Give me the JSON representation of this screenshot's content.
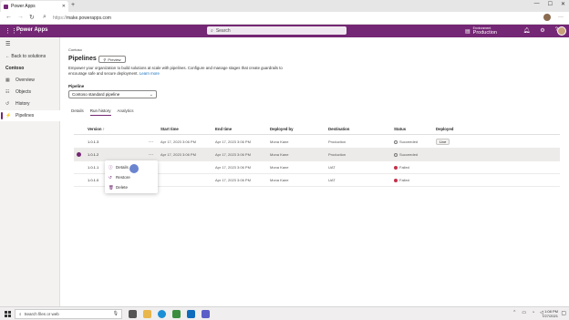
{
  "browser": {
    "tab_title": "Power Apps",
    "tab_close": "✕",
    "new_tab": "+",
    "url_prefix": "https://",
    "url": "make.powerapps.com"
  },
  "header": {
    "app_name": "Power Apps",
    "search_placeholder": "Search",
    "environment_label": "Environment",
    "environment_value": "Production"
  },
  "sidebar": {
    "back_label": "Back to solutions",
    "section": "Contoso",
    "items": [
      {
        "label": "Overview",
        "icon": "overview-icon"
      },
      {
        "label": "Objects",
        "icon": "objects-icon"
      },
      {
        "label": "History",
        "icon": "history-icon"
      },
      {
        "label": "Pipelines",
        "icon": "pipelines-icon",
        "active": true
      }
    ]
  },
  "main": {
    "breadcrumb": "Contoso",
    "title": "Pipelines",
    "preview_label": "Preview",
    "description": "Empower your organization to build solutions at scale with pipelines. Configure and manage stages that create guardrails to encourage safe and secure deployment.",
    "learn_more": "Learn more",
    "pipeline_label": "Pipeline",
    "pipeline_value": "Contoso standard pipeline",
    "tabs": [
      {
        "label": "Details"
      },
      {
        "label": "Run history",
        "active": true
      },
      {
        "label": "Analytics"
      }
    ]
  },
  "grid": {
    "columns": [
      "Version",
      "Start time",
      "End time",
      "Deployed by",
      "Destination",
      "Status",
      "Deployed"
    ],
    "sort_indicator": "↑",
    "row_menu": "···",
    "rows": [
      {
        "version": "1.0.1.3",
        "start": "Apr 17, 2023 3:06 PM",
        "end": "Apr 17, 2023 3:06 PM",
        "by": "Mona Kane",
        "dest": "Production",
        "status": "Succeeded",
        "deployed": "Live"
      },
      {
        "version": "1.0.1.2",
        "start": "Apr 17, 2023 3:06 PM",
        "end": "Apr 17, 2023 3:06 PM",
        "by": "Mona Kane",
        "dest": "Production",
        "status": "Succeeded",
        "deployed": ""
      },
      {
        "version": "1.0.1.1",
        "start": "Apr 17, 2023 3:06 PM",
        "end": "Apr 17, 2023 3:06 PM",
        "by": "Mona Kane",
        "dest": "UAT",
        "status": "Failed",
        "deployed": ""
      },
      {
        "version": "1.0.1.0",
        "start": "Apr 17, 2023 3:06 PM",
        "end": "Apr 17, 2023 3:06 PM",
        "by": "Mona Kane",
        "dest": "UAT",
        "status": "Failed",
        "deployed": ""
      }
    ]
  },
  "context_menu": {
    "items": [
      "Details",
      "Restore",
      "Delete"
    ]
  },
  "taskbar": {
    "search_placeholder": "Search files or web",
    "time": "1:08 PM",
    "date": "7/27/2021"
  },
  "colors": {
    "brand": "#742774",
    "failed": "#c4314b"
  }
}
